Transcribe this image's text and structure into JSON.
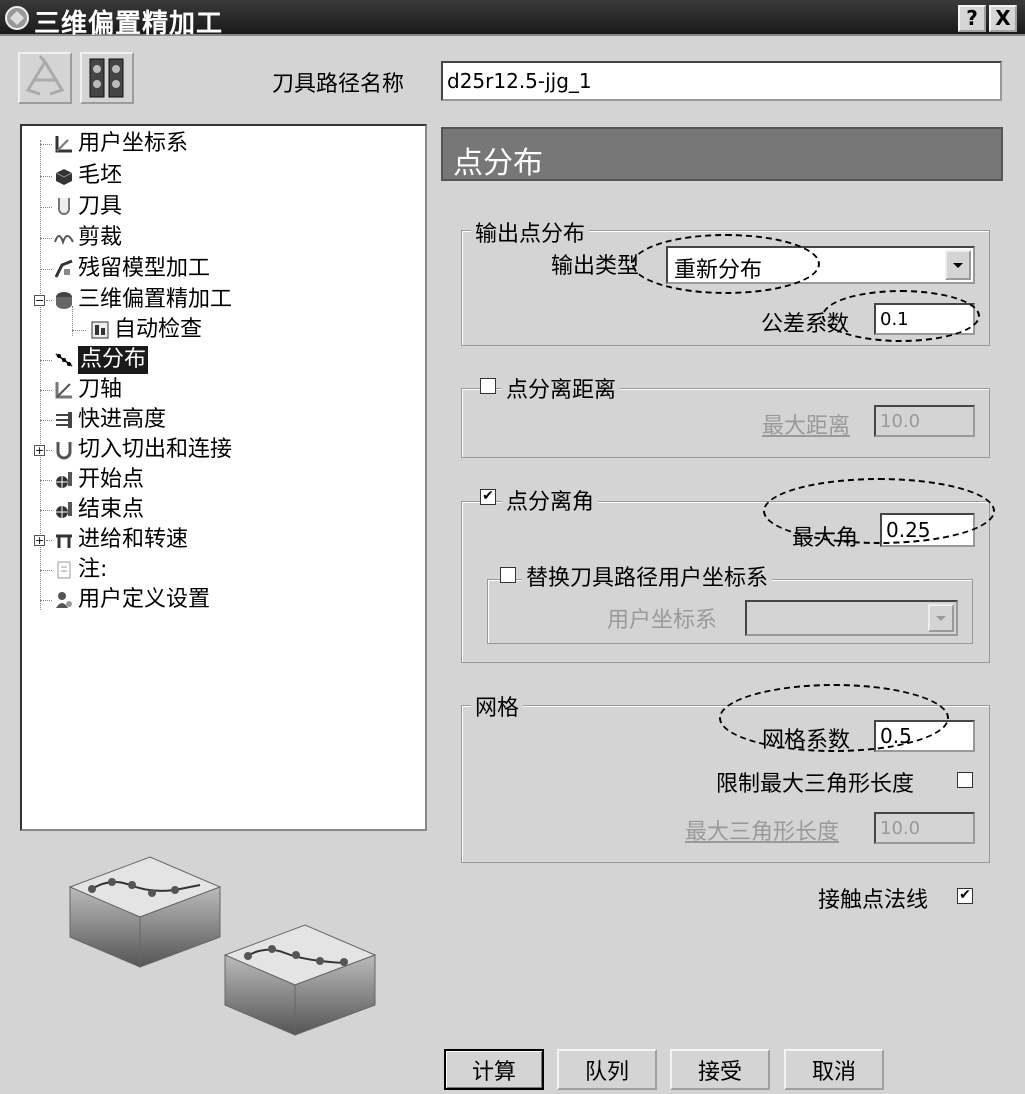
{
  "window": {
    "title": "三维偏置精加工",
    "help_label": "?",
    "close_label": "X"
  },
  "toolbar": {
    "icons": [
      "recycle-icon",
      "library-icon"
    ]
  },
  "toolpath_name": {
    "label": "刀具路径名称",
    "value": "d25r12.5-jjg_1"
  },
  "tree": {
    "items": [
      {
        "label": "用户坐标系",
        "icon": "ucs-icon"
      },
      {
        "label": "毛坯",
        "icon": "block-icon"
      },
      {
        "label": "刀具",
        "icon": "tool-icon"
      },
      {
        "label": "剪裁",
        "icon": "trim-icon"
      },
      {
        "label": "残留模型加工",
        "icon": "rest-model-icon"
      },
      {
        "label": "三维偏置精加工",
        "icon": "finishing-icon",
        "expander": "−"
      },
      {
        "label": "自动检查",
        "icon": "auto-check-icon"
      },
      {
        "label": "点分布",
        "icon": "point-distribution-icon",
        "selected": true
      },
      {
        "label": "刀轴",
        "icon": "tool-axis-icon"
      },
      {
        "label": "快进高度",
        "icon": "rapid-height-icon"
      },
      {
        "label": "切入切出和连接",
        "icon": "leads-links-icon",
        "expander": "+"
      },
      {
        "label": "开始点",
        "icon": "start-point-icon"
      },
      {
        "label": "结束点",
        "icon": "end-point-icon"
      },
      {
        "label": "进给和转速",
        "icon": "feeds-speeds-icon",
        "expander": "+"
      },
      {
        "label": "注:",
        "icon": "notes-icon"
      },
      {
        "label": "用户定义设置",
        "icon": "user-settings-icon"
      }
    ]
  },
  "section": {
    "title": "点分布"
  },
  "output_group": {
    "title": "输出点分布",
    "type_label": "输出类型",
    "type_value": "重新分布",
    "tolerance_label": "公差系数",
    "tolerance_value": "0.1"
  },
  "separation_distance": {
    "title": "点分离距离",
    "checked": false,
    "max_distance_label": "最大距离",
    "max_distance_value": "10.0"
  },
  "separation_angle": {
    "title": "点分离角",
    "checked": true,
    "check_mark": "✔",
    "max_angle_label": "最大角",
    "max_angle_value": "0.25",
    "replace_ucs": {
      "title": "替换刀具路径用户坐标系",
      "checked": false,
      "ucs_label": "用户坐标系",
      "ucs_value": ""
    }
  },
  "grid_group": {
    "title": "网格",
    "factor_label": "网格系数",
    "factor_value": "0.5",
    "limit_label": "限制最大三角形长度",
    "limit_checked": false,
    "max_length_label": "最大三角形长度",
    "max_length_value": "10.0"
  },
  "contact_normals": {
    "label": "接触点法线",
    "checked": true,
    "check_mark": "✔"
  },
  "buttons": {
    "calculate": "计算",
    "queue": "队列",
    "accept": "接受",
    "cancel": "取消"
  },
  "colors": {
    "titlebar": "#1a1a1a",
    "dialog_bg": "#d4d4d4",
    "section_header": "#777777",
    "selected_item": "#1a1a1a"
  }
}
